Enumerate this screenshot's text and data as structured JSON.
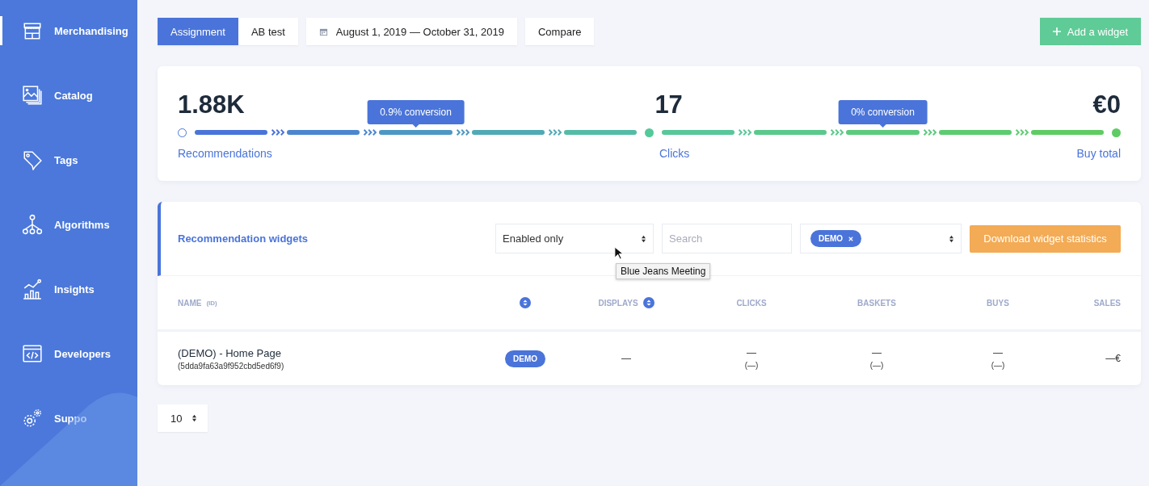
{
  "sidebar": {
    "items": [
      {
        "kind": "store",
        "label": "Merchandising",
        "selected": true
      },
      {
        "kind": "images",
        "label": "Catalog",
        "selected": false
      },
      {
        "kind": "tag",
        "label": "Tags",
        "selected": false
      },
      {
        "kind": "tree",
        "label": "Algorithms",
        "selected": false
      },
      {
        "kind": "chart",
        "label": "Insights",
        "selected": false
      },
      {
        "kind": "code",
        "label": "Developers",
        "selected": false
      },
      {
        "kind": "gears",
        "label": "Suppo",
        "selected": false
      }
    ]
  },
  "toolbar": {
    "mode_tabs": [
      {
        "label": "Assignment",
        "selected": true
      },
      {
        "label": "AB test",
        "selected": false
      }
    ],
    "date_range": "August 1, 2019 — October 31, 2019",
    "compare": "Compare",
    "add_widget": "Add a widget"
  },
  "funnel": {
    "stages": [
      {
        "value": "1.88K",
        "label": "Recommendations"
      },
      {
        "value": "17",
        "label": "Clicks"
      },
      {
        "value": "€0",
        "label": "Buy total"
      }
    ],
    "conversions": [
      "0.9% conversion",
      "0% conversion"
    ]
  },
  "widgets": {
    "title": "Recommendation widgets",
    "status_filter": "Enabled only",
    "search": {
      "placeholder": "Search"
    },
    "tags": [
      "DEMO"
    ],
    "download": "Download widget statistics",
    "columns": [
      {
        "label": "NAME",
        "sub": "(ID)",
        "sortable": false
      },
      {
        "sortable": true
      },
      {
        "label": "DISPLAYS",
        "sortable": true
      },
      {
        "label": "CLICKS",
        "sortable": false
      },
      {
        "label": "BASKETS",
        "sortable": false
      },
      {
        "label": "BUYS",
        "sortable": false
      },
      {
        "label": "SALES",
        "sortable": false
      }
    ],
    "rows": [
      {
        "name": "(DEMO) - Home Page",
        "id": "(5dda9fa63a9f952cbd5ed6f9)",
        "tag": "DEMO",
        "displays": "—",
        "clicks": "—",
        "clicks_rate": "(—)",
        "baskets": "—",
        "baskets_rate": "(—)",
        "buys": "—",
        "buys_rate": "(—)",
        "sales": "—€"
      }
    ]
  },
  "tooltip": "Blue Jeans Meeting",
  "page_size": "10"
}
